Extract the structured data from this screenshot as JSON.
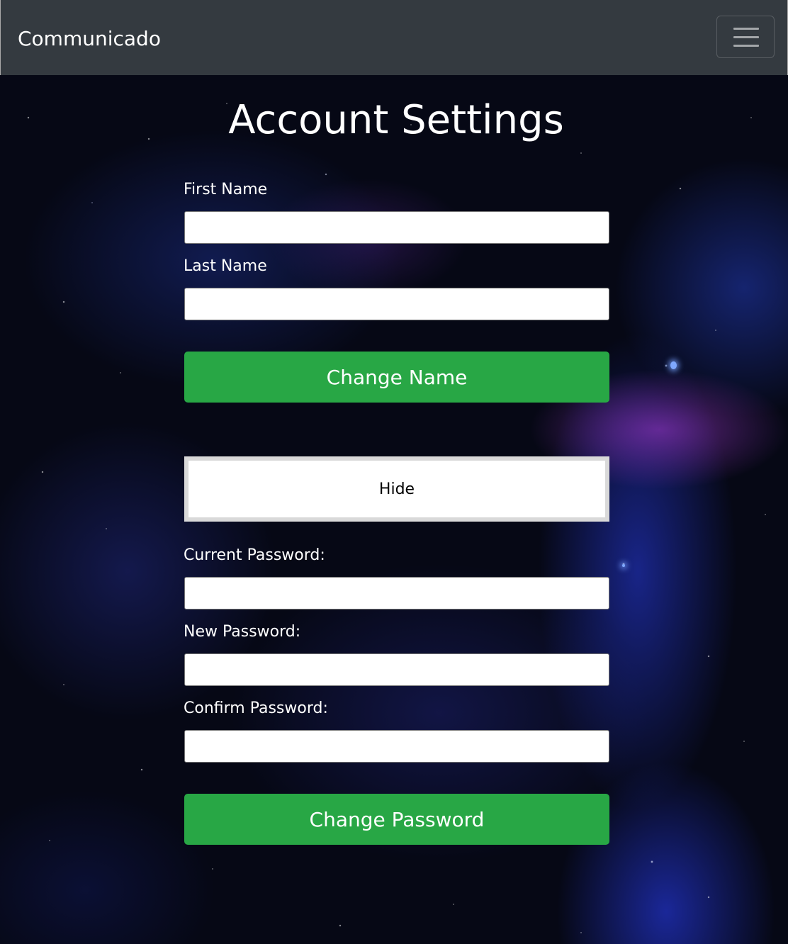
{
  "navbar": {
    "brand": "Communicado",
    "menu_icon": "hamburger-menu-icon",
    "background": "#343a40"
  },
  "main": {
    "title": "Account Settings",
    "name_form": {
      "first_name_label": "First Name",
      "first_name_value": "",
      "last_name_label": "Last Name",
      "last_name_value": "",
      "submit_label": "Change Name"
    },
    "toggle_label": "Hide",
    "password_form": {
      "current_label": "Current Password:",
      "current_value": "",
      "new_label": "New Password:",
      "new_value": "",
      "confirm_label": "Confirm Password:",
      "confirm_value": "",
      "submit_label": "Change Password"
    }
  },
  "colors": {
    "accent_green": "#28a745",
    "text": "#ffffff"
  }
}
